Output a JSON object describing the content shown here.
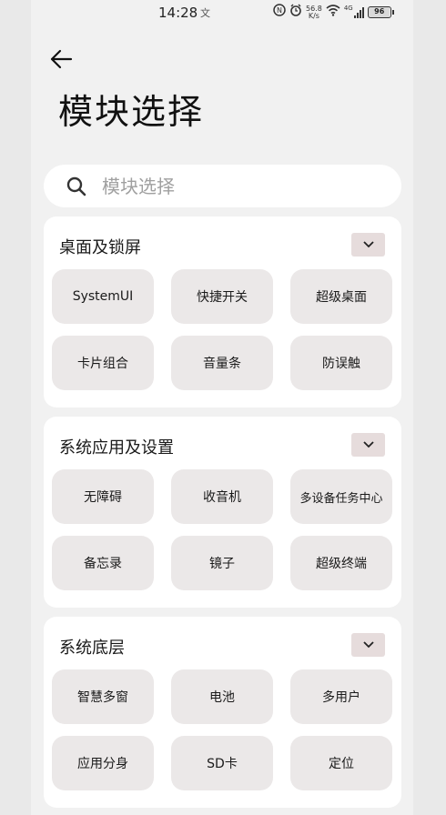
{
  "status_bar": {
    "time": "14:28",
    "time_suffix_icon": "文",
    "network_speed_value": "56.8",
    "network_speed_unit": "K/s",
    "signal_type": "4G",
    "battery_level": "96"
  },
  "header": {
    "back_icon": "arrow-left-icon",
    "title": "模块选择"
  },
  "search": {
    "placeholder": "模块选择",
    "icon": "search-icon"
  },
  "sections": [
    {
      "title": "桌面及锁屏",
      "modules": [
        "SystemUI",
        "快捷开关",
        "超级桌面",
        "卡片组合",
        "音量条",
        "防误触"
      ]
    },
    {
      "title": "系统应用及设置",
      "modules": [
        "无障碍",
        "收音机",
        "多设备任务中心",
        "备忘录",
        "镜子",
        "超级终端"
      ]
    },
    {
      "title": "系统底层",
      "modules": [
        "智慧多窗",
        "电池",
        "多用户",
        "应用分身",
        "SD卡",
        "定位"
      ]
    }
  ],
  "colors": {
    "background": "#f1f1f1",
    "card": "#ffffff",
    "module_button": "#ebe8e8",
    "toggle": "#e6dcdc"
  }
}
